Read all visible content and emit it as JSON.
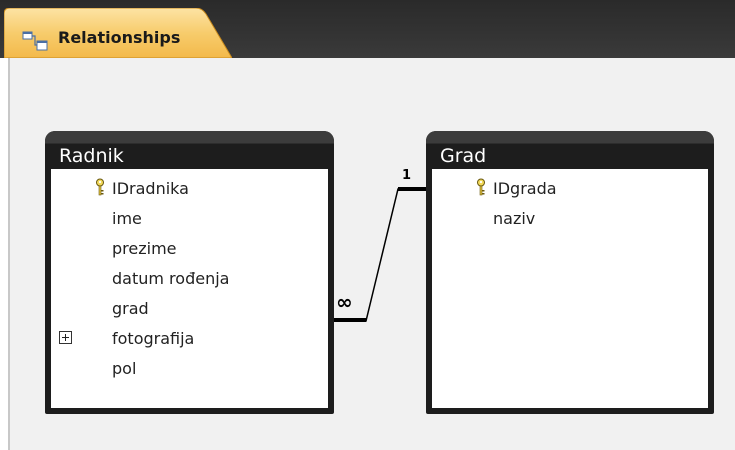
{
  "tab": {
    "label": "Relationships",
    "icon": "relationships-icon"
  },
  "tables": [
    {
      "title": "Radnik",
      "fields": [
        {
          "name": "IDradnika",
          "primary_key": true
        },
        {
          "name": "ime"
        },
        {
          "name": "prezime"
        },
        {
          "name": "datum rođenja"
        },
        {
          "name": "grad"
        },
        {
          "name": "fotografija",
          "expandable": true
        },
        {
          "name": "pol"
        }
      ]
    },
    {
      "title": "Grad",
      "fields": [
        {
          "name": "IDgrada",
          "primary_key": true
        },
        {
          "name": "naziv"
        }
      ]
    }
  ],
  "relationship": {
    "from_table": "Radnik",
    "from_field": "grad",
    "to_table": "Grad",
    "to_field": "IDgrada",
    "one_label": "1",
    "many_label": "∞"
  },
  "colors": {
    "tab_accent": "#f3b94a",
    "table_frame": "#1d1d1d",
    "canvas": "#f1f1f1"
  }
}
